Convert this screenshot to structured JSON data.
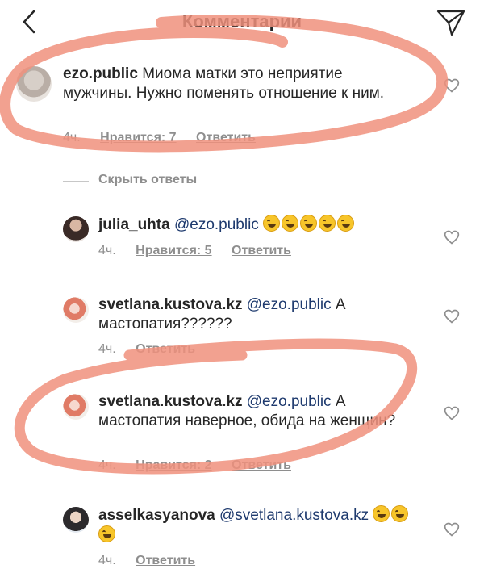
{
  "header": {
    "title": "Комментарии"
  },
  "comments": [
    {
      "username": "ezo.public",
      "mention": "",
      "text": "Миома матки это неприятие мужчины. Нужно поменять отношение к ним.",
      "time": "4ч.",
      "likes": "Нравится: 7",
      "reply": "Ответить"
    },
    {
      "username": "julia_uhta",
      "mention": "@ezo.public",
      "text": "",
      "emoji_count": 5,
      "time": "4ч.",
      "likes": "Нравится: 5",
      "reply": "Ответить"
    },
    {
      "username": "svetlana.kustova.kz",
      "mention": "@ezo.public",
      "text": "А мастопатия??????",
      "time": "4ч.",
      "likes": "",
      "reply": "Ответить"
    },
    {
      "username": "svetlana.kustova.kz",
      "mention": "@ezo.public",
      "text": "А мастопатия наверное, обида на женщин?",
      "time": "4ч.",
      "likes": "Нравится: 2",
      "reply": "Ответить"
    },
    {
      "username": "asselkasyanova",
      "mention": "@svetlana.kustova.kz",
      "text": "",
      "emoji_count": 3,
      "time": "4ч.",
      "likes": "",
      "reply": "Ответить"
    }
  ],
  "replies_toggle": "Скрыть ответы",
  "colors": {
    "annotation": "#f0907d",
    "mention": "#1e3a6e",
    "meta": "#8e8e8e"
  },
  "icons": [
    "back-arrow-icon",
    "send-icon",
    "heart-icon",
    "laughing-emoji-icon"
  ]
}
